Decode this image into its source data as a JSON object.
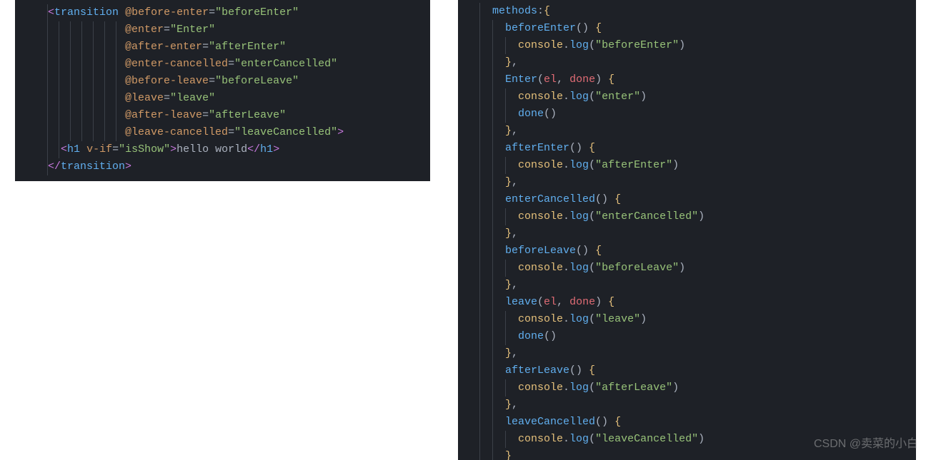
{
  "left": {
    "lines": [
      [
        {
          "cls": "delim",
          "t": "<"
        },
        {
          "cls": "tag",
          "t": "transition"
        },
        {
          "cls": "txt",
          "t": " "
        },
        {
          "cls": "attr",
          "t": "@before-enter"
        },
        {
          "cls": "eq",
          "t": "="
        },
        {
          "cls": "str",
          "t": "\"beforeEnter\""
        }
      ],
      [
        {
          "cls": "attr",
          "t": "@enter"
        },
        {
          "cls": "eq",
          "t": "="
        },
        {
          "cls": "str",
          "t": "\"Enter\""
        }
      ],
      [
        {
          "cls": "attr",
          "t": "@after-enter"
        },
        {
          "cls": "eq",
          "t": "="
        },
        {
          "cls": "str",
          "t": "\"afterEnter\""
        }
      ],
      [
        {
          "cls": "attr",
          "t": "@enter-cancelled"
        },
        {
          "cls": "eq",
          "t": "="
        },
        {
          "cls": "str",
          "t": "\"enterCancelled\""
        }
      ],
      [
        {
          "cls": "attr",
          "t": "@before-leave"
        },
        {
          "cls": "eq",
          "t": "="
        },
        {
          "cls": "str",
          "t": "\"beforeLeave\""
        }
      ],
      [
        {
          "cls": "attr",
          "t": "@leave"
        },
        {
          "cls": "eq",
          "t": "="
        },
        {
          "cls": "str",
          "t": "\"leave\""
        }
      ],
      [
        {
          "cls": "attr",
          "t": "@after-leave"
        },
        {
          "cls": "eq",
          "t": "="
        },
        {
          "cls": "str",
          "t": "\"afterLeave\""
        }
      ],
      [
        {
          "cls": "attr",
          "t": "@leave-cancelled"
        },
        {
          "cls": "eq",
          "t": "="
        },
        {
          "cls": "str",
          "t": "\"leaveCancelled\""
        },
        {
          "cls": "delim",
          "t": ">"
        }
      ],
      [
        {
          "cls": "delim",
          "t": "<"
        },
        {
          "cls": "tag",
          "t": "h1"
        },
        {
          "cls": "txt",
          "t": " "
        },
        {
          "cls": "attr",
          "t": "v-if"
        },
        {
          "cls": "eq",
          "t": "="
        },
        {
          "cls": "str",
          "t": "\"isShow\""
        },
        {
          "cls": "delim",
          "t": ">"
        },
        {
          "cls": "txt",
          "t": "hello world"
        },
        {
          "cls": "delim",
          "t": "</"
        },
        {
          "cls": "tag",
          "t": "h1"
        },
        {
          "cls": "delim",
          "t": ">"
        }
      ],
      [
        {
          "cls": "delim",
          "t": "</"
        },
        {
          "cls": "tag",
          "t": "transition"
        },
        {
          "cls": "delim",
          "t": ">"
        }
      ]
    ],
    "indents": [
      0,
      14,
      14,
      14,
      14,
      14,
      14,
      14,
      2,
      0
    ],
    "prefixIndent": 2,
    "guideCounts": [
      1,
      7,
      7,
      7,
      7,
      7,
      7,
      7,
      2,
      1
    ]
  },
  "right": {
    "lines": [
      [
        {
          "cls": "fn",
          "t": "methods"
        },
        {
          "cls": "punct",
          "t": ":"
        },
        {
          "cls": "prop",
          "t": "{"
        }
      ],
      [
        {
          "cls": "fn",
          "t": "beforeEnter"
        },
        {
          "cls": "punct",
          "t": "() "
        },
        {
          "cls": "prop",
          "t": "{"
        }
      ],
      [
        {
          "cls": "prop",
          "t": "console"
        },
        {
          "cls": "punct",
          "t": "."
        },
        {
          "cls": "fn",
          "t": "log"
        },
        {
          "cls": "punct",
          "t": "("
        },
        {
          "cls": "str",
          "t": "\"beforeEnter\""
        },
        {
          "cls": "punct",
          "t": ")"
        }
      ],
      [
        {
          "cls": "prop",
          "t": "}"
        },
        {
          "cls": "punct",
          "t": ","
        }
      ],
      [
        {
          "cls": "fn",
          "t": "Enter"
        },
        {
          "cls": "punct",
          "t": "("
        },
        {
          "cls": "param",
          "t": "el"
        },
        {
          "cls": "punct",
          "t": ", "
        },
        {
          "cls": "param",
          "t": "done"
        },
        {
          "cls": "punct",
          "t": ") "
        },
        {
          "cls": "prop",
          "t": "{"
        }
      ],
      [
        {
          "cls": "prop",
          "t": "console"
        },
        {
          "cls": "punct",
          "t": "."
        },
        {
          "cls": "fn",
          "t": "log"
        },
        {
          "cls": "punct",
          "t": "("
        },
        {
          "cls": "str",
          "t": "\"enter\""
        },
        {
          "cls": "punct",
          "t": ")"
        }
      ],
      [
        {
          "cls": "fn",
          "t": "done"
        },
        {
          "cls": "punct",
          "t": "()"
        }
      ],
      [
        {
          "cls": "prop",
          "t": "}"
        },
        {
          "cls": "punct",
          "t": ","
        }
      ],
      [
        {
          "cls": "fn",
          "t": "afterEnter"
        },
        {
          "cls": "punct",
          "t": "() "
        },
        {
          "cls": "prop",
          "t": "{"
        }
      ],
      [
        {
          "cls": "prop",
          "t": "console"
        },
        {
          "cls": "punct",
          "t": "."
        },
        {
          "cls": "fn",
          "t": "log"
        },
        {
          "cls": "punct",
          "t": "("
        },
        {
          "cls": "str",
          "t": "\"afterEnter\""
        },
        {
          "cls": "punct",
          "t": ")"
        }
      ],
      [
        {
          "cls": "prop",
          "t": "}"
        },
        {
          "cls": "punct",
          "t": ","
        }
      ],
      [
        {
          "cls": "fn",
          "t": "enterCancelled"
        },
        {
          "cls": "punct",
          "t": "() "
        },
        {
          "cls": "prop",
          "t": "{"
        }
      ],
      [
        {
          "cls": "prop",
          "t": "console"
        },
        {
          "cls": "punct",
          "t": "."
        },
        {
          "cls": "fn",
          "t": "log"
        },
        {
          "cls": "punct",
          "t": "("
        },
        {
          "cls": "str",
          "t": "\"enterCancelled\""
        },
        {
          "cls": "punct",
          "t": ")"
        }
      ],
      [
        {
          "cls": "prop",
          "t": "}"
        },
        {
          "cls": "punct",
          "t": ","
        }
      ],
      [
        {
          "cls": "fn",
          "t": "beforeLeave"
        },
        {
          "cls": "punct",
          "t": "() "
        },
        {
          "cls": "prop",
          "t": "{"
        }
      ],
      [
        {
          "cls": "prop",
          "t": "console"
        },
        {
          "cls": "punct",
          "t": "."
        },
        {
          "cls": "fn",
          "t": "log"
        },
        {
          "cls": "punct",
          "t": "("
        },
        {
          "cls": "str",
          "t": "\"beforeLeave\""
        },
        {
          "cls": "punct",
          "t": ")"
        }
      ],
      [
        {
          "cls": "prop",
          "t": "}"
        },
        {
          "cls": "punct",
          "t": ","
        }
      ],
      [
        {
          "cls": "fn",
          "t": "leave"
        },
        {
          "cls": "punct",
          "t": "("
        },
        {
          "cls": "param",
          "t": "el"
        },
        {
          "cls": "punct",
          "t": ", "
        },
        {
          "cls": "param",
          "t": "done"
        },
        {
          "cls": "punct",
          "t": ") "
        },
        {
          "cls": "prop",
          "t": "{"
        }
      ],
      [
        {
          "cls": "prop",
          "t": "console"
        },
        {
          "cls": "punct",
          "t": "."
        },
        {
          "cls": "fn",
          "t": "log"
        },
        {
          "cls": "punct",
          "t": "("
        },
        {
          "cls": "str",
          "t": "\"leave\""
        },
        {
          "cls": "punct",
          "t": ")"
        }
      ],
      [
        {
          "cls": "fn",
          "t": "done"
        },
        {
          "cls": "punct",
          "t": "()"
        }
      ],
      [
        {
          "cls": "prop",
          "t": "}"
        },
        {
          "cls": "punct",
          "t": ","
        }
      ],
      [
        {
          "cls": "fn",
          "t": "afterLeave"
        },
        {
          "cls": "punct",
          "t": "() "
        },
        {
          "cls": "prop",
          "t": "{"
        }
      ],
      [
        {
          "cls": "prop",
          "t": "console"
        },
        {
          "cls": "punct",
          "t": "."
        },
        {
          "cls": "fn",
          "t": "log"
        },
        {
          "cls": "punct",
          "t": "("
        },
        {
          "cls": "str",
          "t": "\"afterLeave\""
        },
        {
          "cls": "punct",
          "t": ")"
        }
      ],
      [
        {
          "cls": "prop",
          "t": "}"
        },
        {
          "cls": "punct",
          "t": ","
        }
      ],
      [
        {
          "cls": "fn",
          "t": "leaveCancelled"
        },
        {
          "cls": "punct",
          "t": "() "
        },
        {
          "cls": "prop",
          "t": "{"
        }
      ],
      [
        {
          "cls": "prop",
          "t": "console"
        },
        {
          "cls": "punct",
          "t": "."
        },
        {
          "cls": "fn",
          "t": "log"
        },
        {
          "cls": "punct",
          "t": "("
        },
        {
          "cls": "str",
          "t": "\"leaveCancelled\""
        },
        {
          "cls": "punct",
          "t": ")"
        }
      ],
      [
        {
          "cls": "prop",
          "t": "}"
        }
      ]
    ],
    "indents": [
      1,
      2,
      3,
      2,
      2,
      3,
      3,
      2,
      2,
      3,
      2,
      2,
      3,
      2,
      2,
      3,
      2,
      2,
      3,
      3,
      2,
      2,
      3,
      2,
      2,
      3,
      2
    ]
  },
  "watermark": "CSDN @卖菜的小白"
}
